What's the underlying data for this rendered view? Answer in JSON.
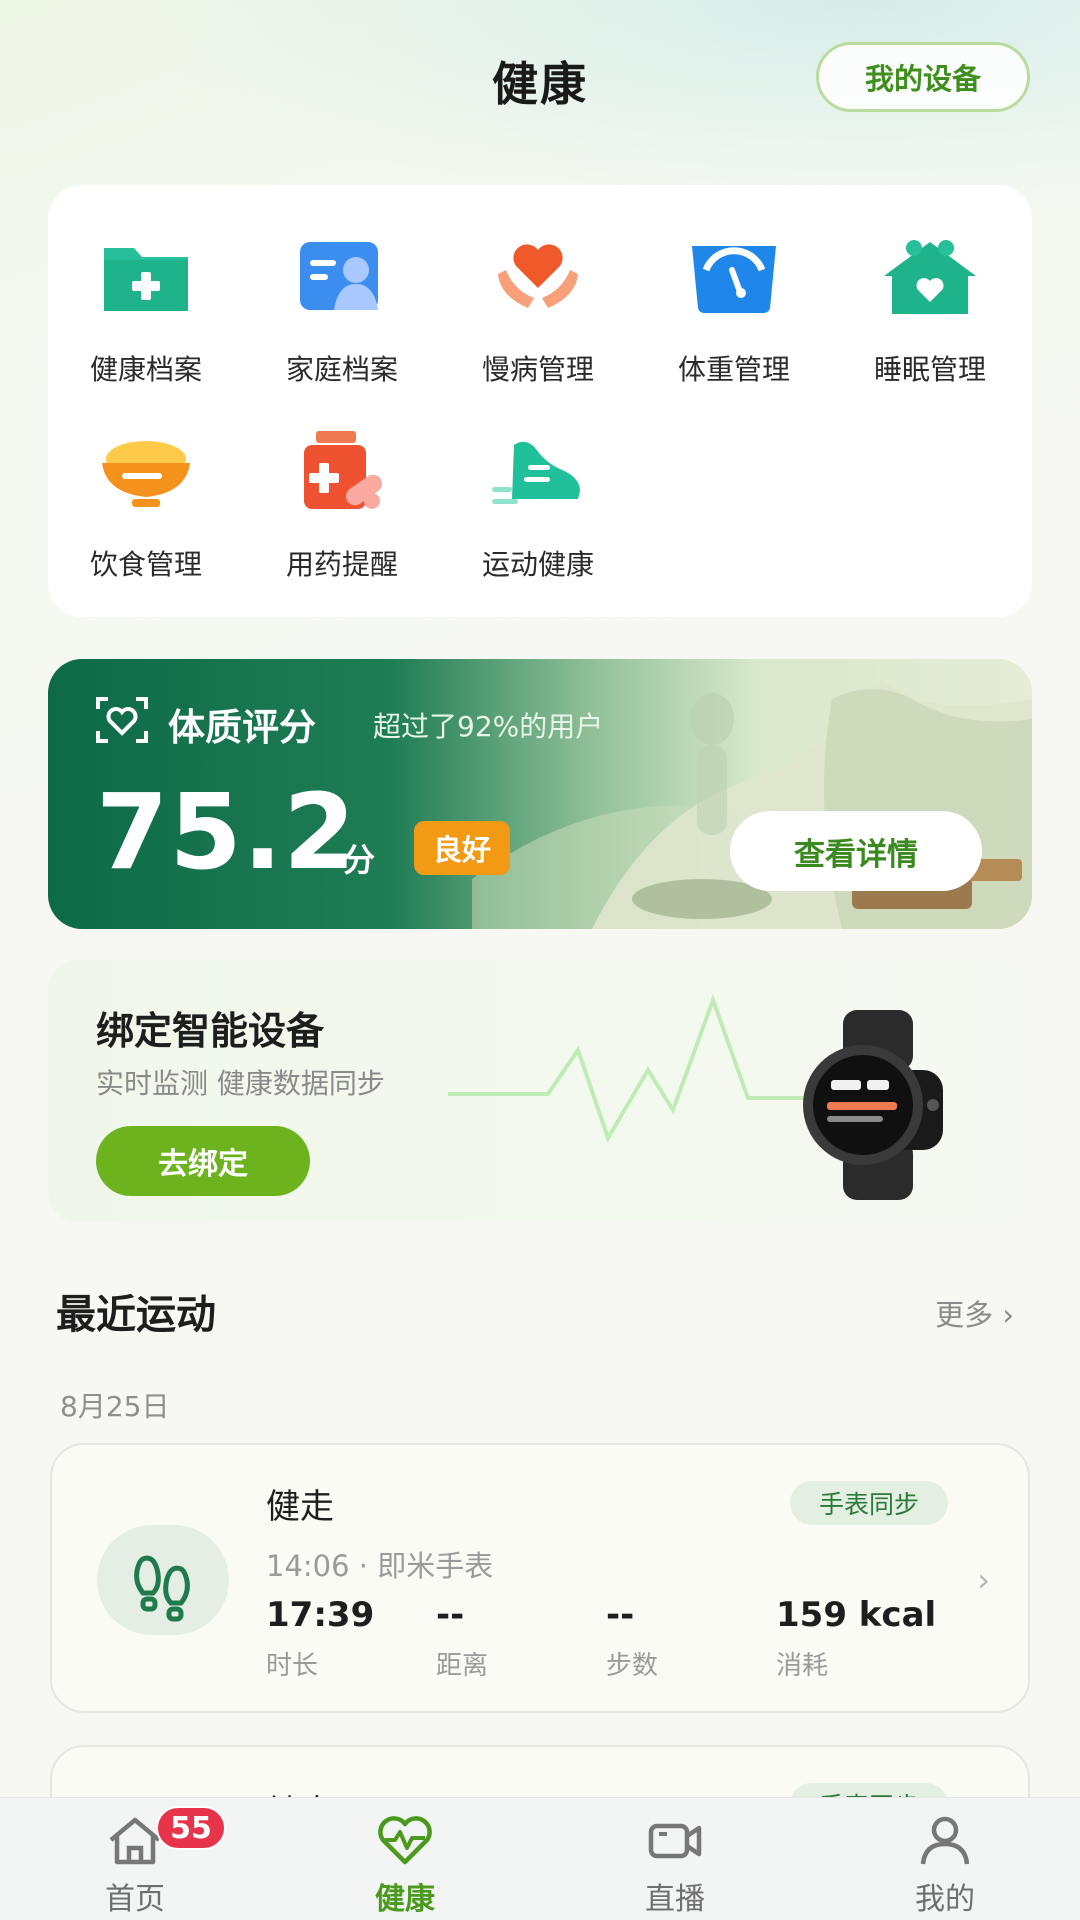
{
  "header": {
    "title": "健康",
    "device_button": "我的设备"
  },
  "features": [
    {
      "label": "健康档案",
      "icon": "folder-plus-icon"
    },
    {
      "label": "家庭档案",
      "icon": "family-profile-icon"
    },
    {
      "label": "慢病管理",
      "icon": "heart-hands-icon"
    },
    {
      "label": "体重管理",
      "icon": "scale-icon"
    },
    {
      "label": "睡眠管理",
      "icon": "house-heart-icon"
    },
    {
      "label": "饮食管理",
      "icon": "bowl-icon"
    },
    {
      "label": "用药提醒",
      "icon": "medicine-bottle-icon"
    },
    {
      "label": "运动健康",
      "icon": "running-shoe-icon"
    }
  ],
  "constitution": {
    "title": "体质评分",
    "subtitle": "超过了92%的用户",
    "score": "75.2",
    "unit": "分",
    "level": "良好",
    "detail_button": "查看详情"
  },
  "bind_device": {
    "title": "绑定智能设备",
    "subtitle": "实时监测 健康数据同步",
    "button": "去绑定"
  },
  "recent": {
    "title": "最近运动",
    "more": "更多 ›",
    "date": "8月25日",
    "activities": [
      {
        "name": "健走",
        "sync": "手表同步",
        "meta": "14:06 · 即米手表",
        "stats": [
          {
            "value": "17:39",
            "label": "时长"
          },
          {
            "value": "--",
            "label": "距离"
          },
          {
            "value": "--",
            "label": "步数"
          },
          {
            "value": "159 kcal",
            "label": "消耗"
          }
        ]
      },
      {
        "name": "健走",
        "sync": "手表同步"
      }
    ]
  },
  "nav": {
    "items": [
      {
        "label": "首页",
        "icon": "home-icon",
        "badge": "55"
      },
      {
        "label": "健康",
        "icon": "heart-pulse-icon"
      },
      {
        "label": "直播",
        "icon": "video-camera-icon"
      },
      {
        "label": "我的",
        "icon": "person-icon"
      }
    ]
  },
  "colors": {
    "accent_green": "#4b9a1e",
    "button_green": "#6db31e",
    "badge_orange": "#f39a14",
    "badge_red": "#e8344a",
    "banner_dark_green": "#0d6a47"
  }
}
